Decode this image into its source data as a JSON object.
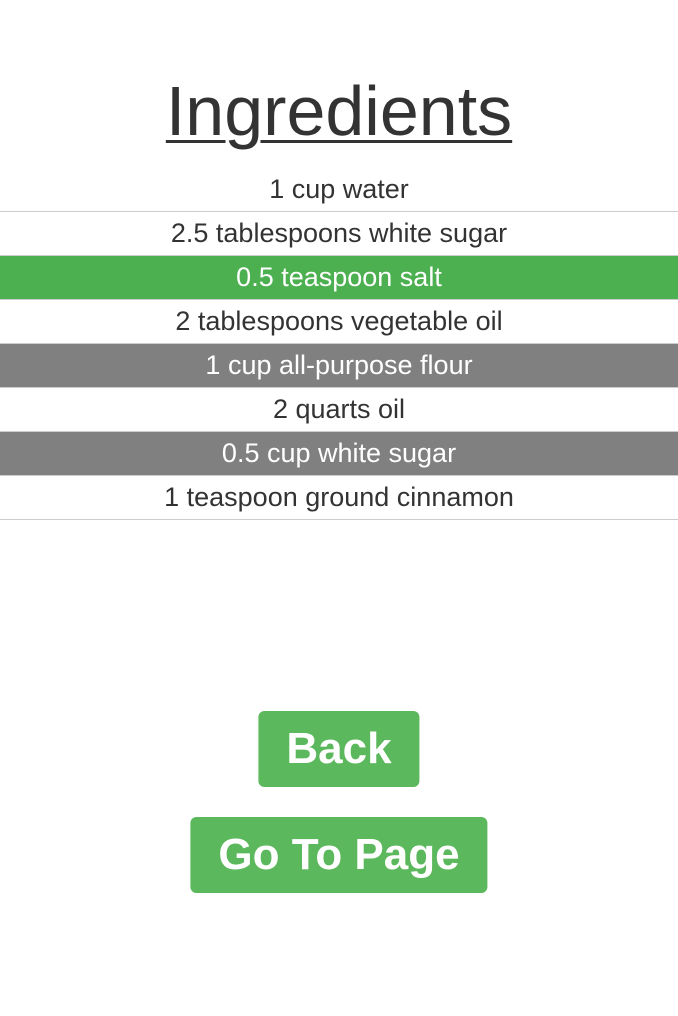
{
  "page": {
    "title": "Ingredients"
  },
  "ingredients": [
    {
      "text": "1 cup water",
      "state": "normal"
    },
    {
      "text": "2.5 tablespoons white sugar",
      "state": "normal"
    },
    {
      "text": "0.5 teaspoon salt",
      "state": "selected"
    },
    {
      "text": "2 tablespoons vegetable oil",
      "state": "normal"
    },
    {
      "text": "1 cup all-purpose flour",
      "state": "muted"
    },
    {
      "text": "2 quarts oil",
      "state": "normal"
    },
    {
      "text": "0.5 cup white sugar",
      "state": "muted"
    },
    {
      "text": "1 teaspoon ground cinnamon",
      "state": "normal"
    }
  ],
  "buttons": {
    "back_label": "Back",
    "go_label": "Go To Page"
  },
  "colors": {
    "selected": "#4caf50",
    "muted": "#808080",
    "button": "#5cb85c"
  }
}
